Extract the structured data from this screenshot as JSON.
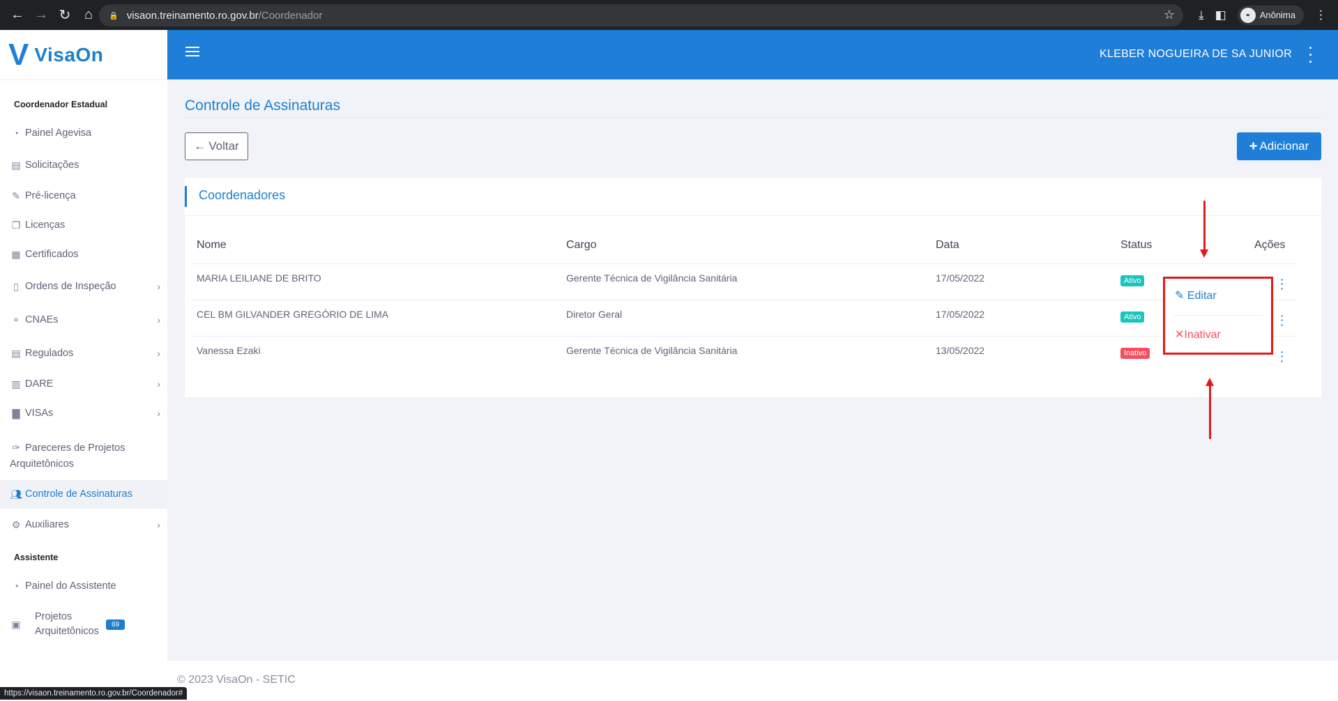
{
  "browser": {
    "host": "visaon.treinamento.ro.gov.br",
    "path": "/Coordenador",
    "profile_label": "Anônima",
    "status_url": "https://visaon.treinamento.ro.gov.br/Coordenador#"
  },
  "brand": {
    "logo_letter": "V",
    "name": "VisaOn"
  },
  "header": {
    "user_name": "KLEBER NOGUEIRA DE SA JUNIOR"
  },
  "sidebar": {
    "section1": "Coordenador Estadual",
    "items": [
      {
        "label": "Painel Agevisa",
        "icon": "dashboard-icon"
      },
      {
        "label": "Solicitações",
        "icon": "clipboard-icon"
      },
      {
        "label": "Pré-licença",
        "icon": "edit-document-icon"
      },
      {
        "label": "Licenças",
        "icon": "files-icon"
      },
      {
        "label": "Certificados",
        "icon": "document-icon"
      },
      {
        "label": "Ordens de Inspeção",
        "icon": "file-icon"
      },
      {
        "label": "CNAEs",
        "icon": "sitemap-icon"
      },
      {
        "label": "Regulados",
        "icon": "file-list-icon"
      },
      {
        "label": "DARE",
        "icon": "barcode-icon"
      },
      {
        "label": "VISAs",
        "icon": "building-icon"
      },
      {
        "label": "Pareceres de Projetos Arquitetônicos",
        "icon": "feather-icon"
      },
      {
        "label": "Controle de Assinaturas",
        "icon": "users-icon"
      },
      {
        "label": "Auxiliares",
        "icon": "gears-icon"
      }
    ],
    "section2": "Assistente",
    "items2": [
      {
        "label": "Painel do Assistente",
        "icon": "dashboard-icon"
      },
      {
        "label": "Projetos Arquitetônicos",
        "icon": "blueprint-icon",
        "badge": "69"
      }
    ]
  },
  "page": {
    "title": "Controle de Assinaturas",
    "back_label": "Voltar",
    "add_label": "Adicionar",
    "card_title": "Coordenadores"
  },
  "table": {
    "columns": [
      "Nome",
      "Cargo",
      "Data",
      "Status",
      "Ações"
    ],
    "rows": [
      {
        "nome": "MARIA LEILIANE DE BRITO",
        "cargo": "Gerente Técnica de Vigilância Sanitária",
        "data": "17/05/2022",
        "status": "Ativo"
      },
      {
        "nome": "CEL BM GILVANDER GREGÓRIO DE LIMA",
        "cargo": "Diretor Geral",
        "data": "17/05/2022",
        "status": "Ativo"
      },
      {
        "nome": "Vanessa Ezaki",
        "cargo": "Gerente Técnica de Vigilância Sanitária",
        "data": "13/05/2022",
        "status": "Inativo"
      }
    ]
  },
  "dropdown": {
    "edit_label": "Editar",
    "inactivate_label": "Inativar"
  },
  "footer": {
    "text": "© 2023 VisaOn - SETIC"
  },
  "colors": {
    "primary": "#1e7ed8",
    "success": "#1bc5bd",
    "danger": "#f64e60",
    "annotation": "#e3191c"
  }
}
